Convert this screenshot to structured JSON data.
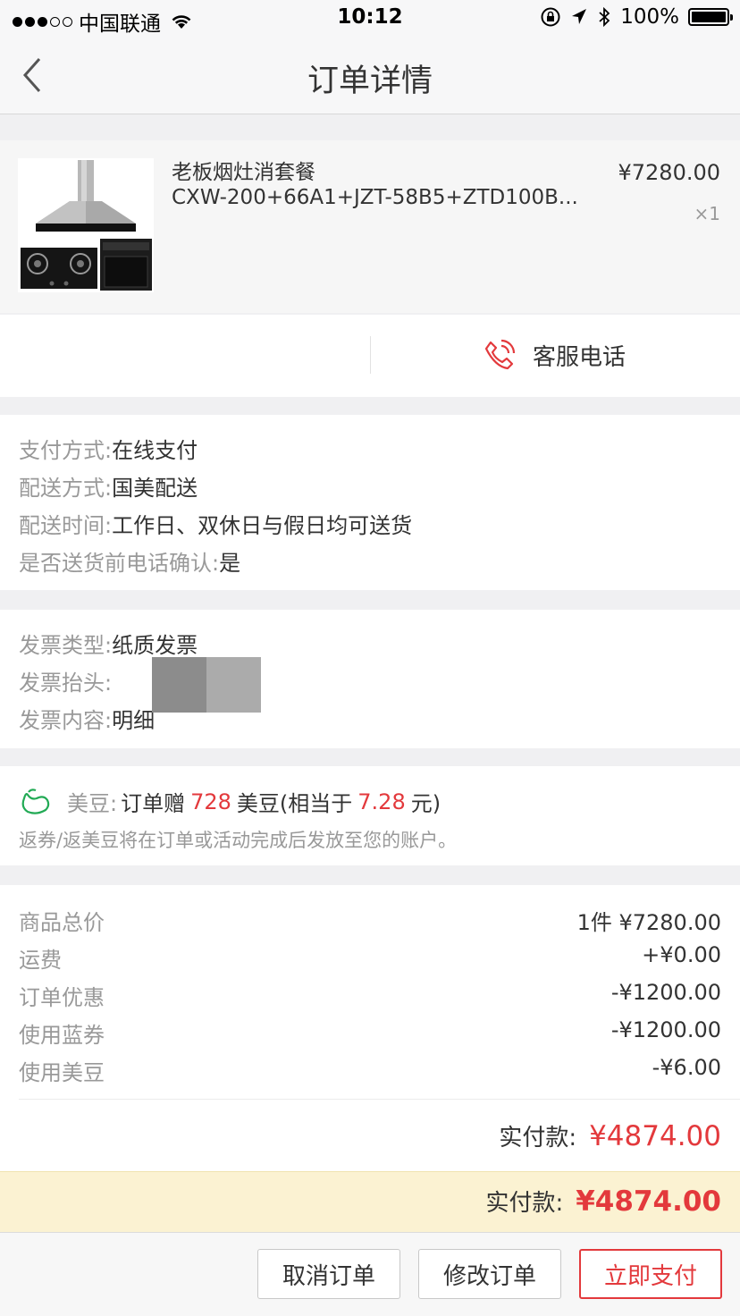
{
  "status_bar": {
    "carrier": "中国联通",
    "time": "10:12",
    "battery": "100%"
  },
  "navbar": {
    "title": "订单详情"
  },
  "product": {
    "name": "老板烟灶消套餐",
    "model": "CXW-200+66A1+JZT-58B5+ZTD100B...",
    "price": "¥7280.00",
    "quantity": "×1"
  },
  "service": {
    "call_label": "客服电话",
    "accent": "#e3393c"
  },
  "payment_info": [
    {
      "key": "支付方式:",
      "value": "在线支付"
    },
    {
      "key": "配送方式:",
      "value": "国美配送"
    },
    {
      "key": "配送时间:",
      "value": "工作日、双休日与假日均可送货"
    },
    {
      "key": "是否送货前电话确认:",
      "value": "是"
    }
  ],
  "invoice_info": [
    {
      "key": "发票类型:",
      "value": "纸质发票"
    },
    {
      "key": "发票抬头:",
      "value": ""
    },
    {
      "key": "发票内容:",
      "value": "明细"
    }
  ],
  "bean": {
    "label": "美豆:",
    "prefix": "订单赠",
    "amount": "728",
    "mid": "美豆(相当于",
    "value": "7.28",
    "suffix": "元)",
    "note": "返券/返美豆将在订单或活动完成后发放至您的账户。"
  },
  "summary": [
    {
      "key": "商品总价",
      "value": "1件 ¥7280.00"
    },
    {
      "key": "运费",
      "value": "+¥0.00"
    },
    {
      "key": "订单优惠",
      "value": "-¥1200.00"
    },
    {
      "key": "使用蓝券",
      "value": "-¥1200.00"
    },
    {
      "key": "使用美豆",
      "value": "-¥6.00"
    }
  ],
  "total": {
    "label": "实付款:",
    "amount": "¥4874.00"
  },
  "pay_bar": {
    "label": "实付款:",
    "amount": "¥4874.00"
  },
  "actions": {
    "cancel": "取消订单",
    "modify": "修改订单",
    "pay": "立即支付"
  }
}
